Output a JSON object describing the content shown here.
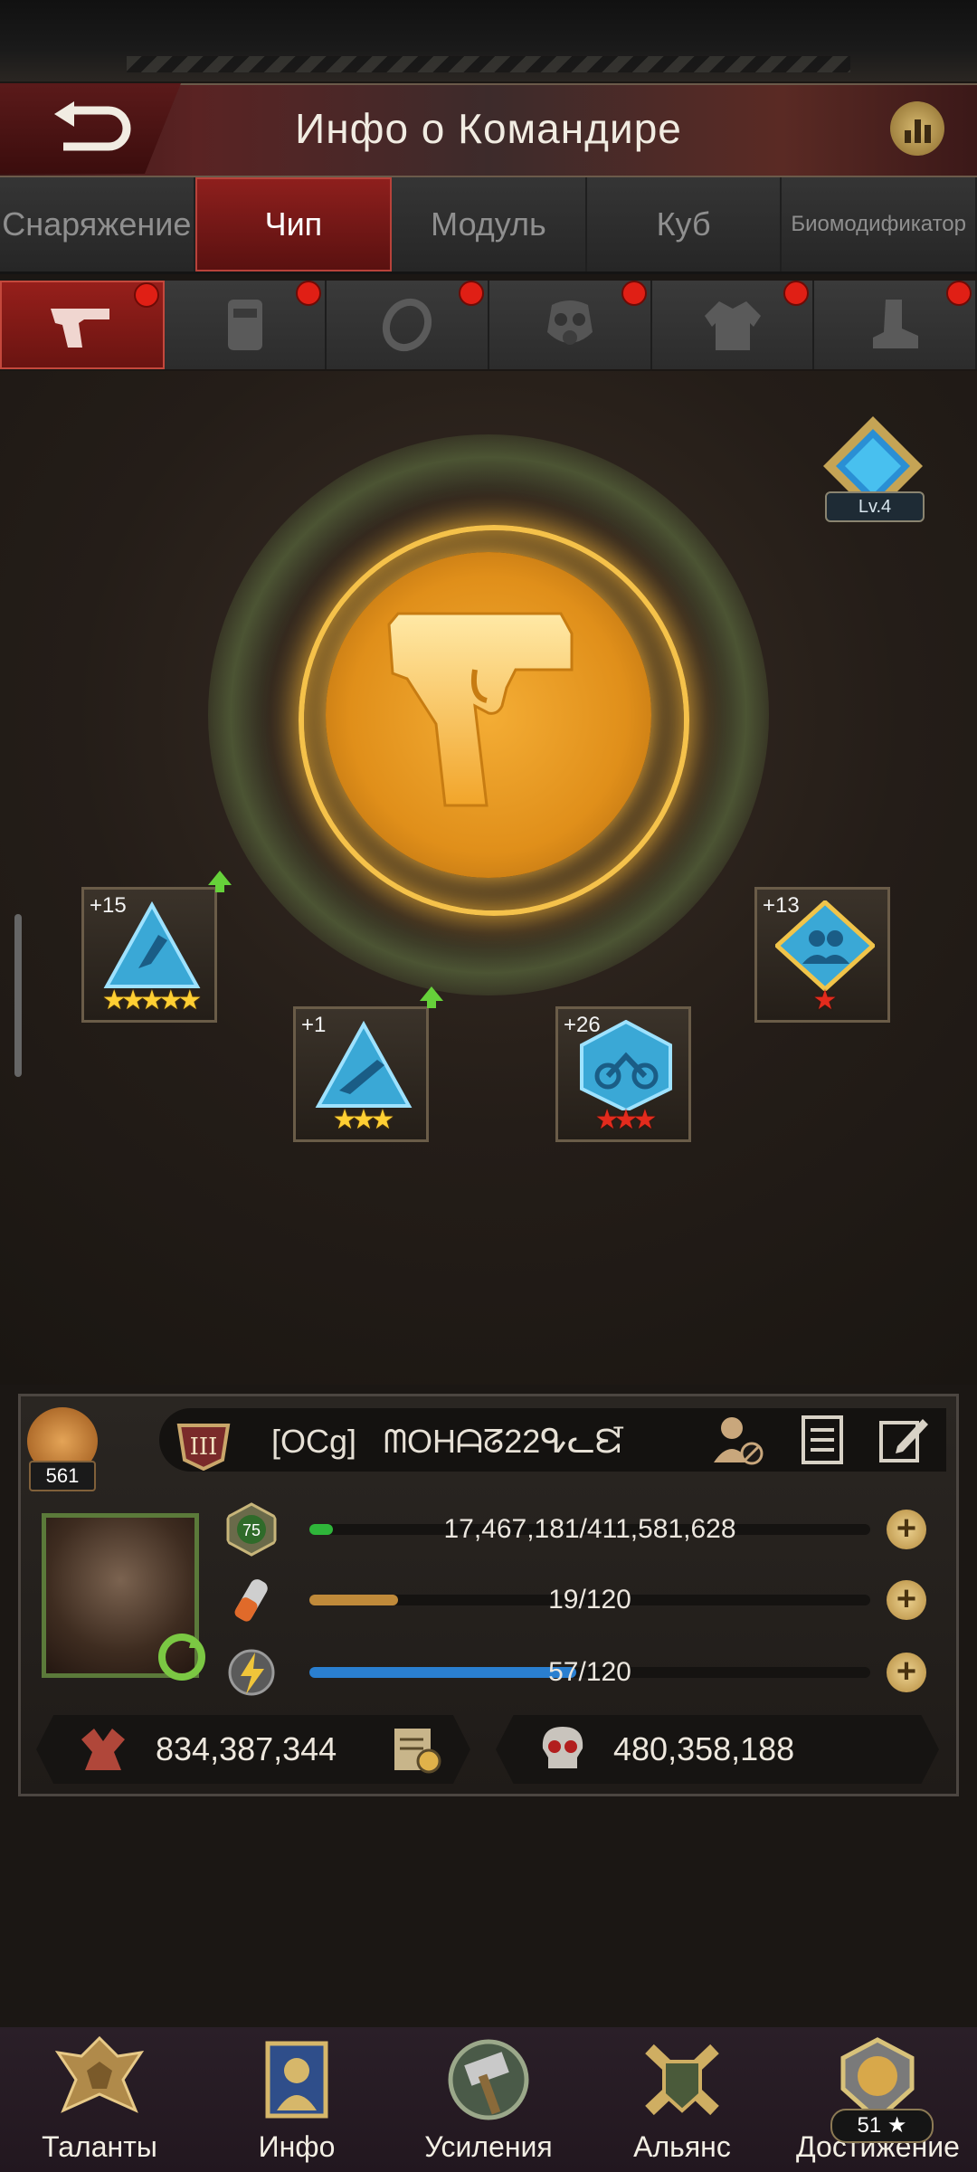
{
  "header": {
    "title": "Инфо о Командире"
  },
  "tabs": [
    {
      "label": "Снаряжение",
      "active": false
    },
    {
      "label": "Чип",
      "active": true
    },
    {
      "label": "Модуль",
      "active": false
    },
    {
      "label": "Куб",
      "active": false
    },
    {
      "label": "Биомодификатор",
      "active": false
    }
  ],
  "slots": [
    {
      "icon": "pistol-icon",
      "active": true,
      "notification": true
    },
    {
      "icon": "vest-icon",
      "active": false,
      "notification": true
    },
    {
      "icon": "ring-icon",
      "active": false,
      "notification": true
    },
    {
      "icon": "gas-mask-icon",
      "active": false,
      "notification": true
    },
    {
      "icon": "jacket-icon",
      "active": false,
      "notification": true
    },
    {
      "icon": "boot-icon",
      "active": false,
      "notification": true
    }
  ],
  "equipment": {
    "icon": "pistol-icon",
    "level_label": "Lv.4"
  },
  "chips": [
    {
      "plus": "+15",
      "stars": "★★★★★",
      "star_color": "gold",
      "upgrade": true,
      "icon": "blue-triangle-chip-icon"
    },
    {
      "plus": "+1",
      "stars": "★★★",
      "star_color": "gold",
      "upgrade": true,
      "icon": "blue-triangle-rifle-chip-icon"
    },
    {
      "plus": "+26",
      "stars": "★★★",
      "star_color": "red",
      "upgrade": false,
      "icon": "blue-hexagon-motorcycle-chip-icon"
    },
    {
      "plus": "+13",
      "stars": "★",
      "star_color": "red",
      "upgrade": false,
      "icon": "blue-diamond-team-chip-icon"
    }
  ],
  "commander": {
    "likes": "561",
    "name": "[OCg]   ᗰOHᗩᘔ22ᕴᓚᘿ",
    "level": "75",
    "stats": [
      {
        "icon": "level-icon",
        "value": "17,467,181/411,581,628",
        "fraction": 0.042,
        "color": "#2fb63a"
      },
      {
        "icon": "stamina-icon",
        "value": "19/120",
        "fraction": 0.158,
        "color": "#c08a3a"
      },
      {
        "icon": "energy-icon",
        "value": "57/120",
        "fraction": 0.475,
        "color": "#2a7fd0"
      }
    ],
    "power": "834,387,344",
    "kills": "480,358,188"
  },
  "bottom_nav": [
    {
      "label": "Таланты",
      "icon": "talents-icon"
    },
    {
      "label": "Инфо",
      "icon": "info-icon"
    },
    {
      "label": "Усиления",
      "icon": "boosts-icon"
    },
    {
      "label": "Альянс",
      "icon": "alliance-icon"
    },
    {
      "label": "Достижение",
      "icon": "achievements-icon",
      "badge": "51 ★"
    }
  ]
}
